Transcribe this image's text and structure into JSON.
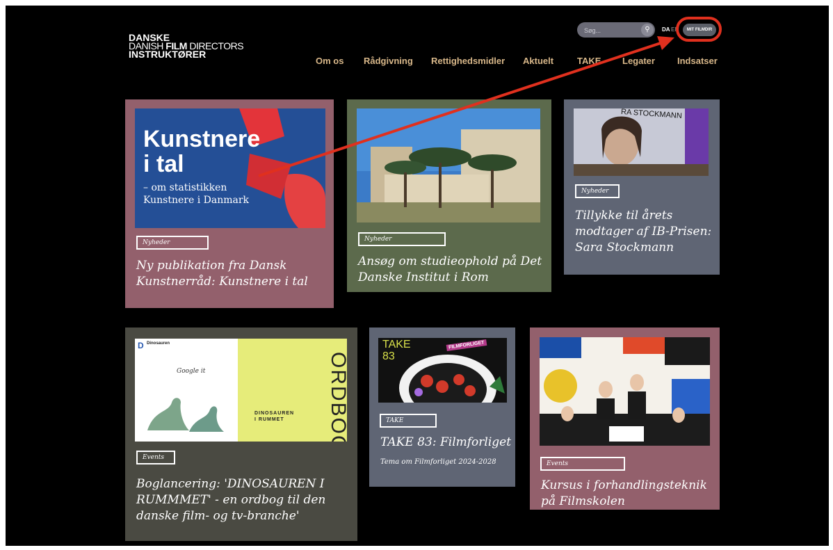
{
  "logo": {
    "line1": "DANSKE",
    "line2a": "DANISH ",
    "line2b": "FILM",
    "line2c": " DIRECTORS",
    "line3": "INSTRUKTØRER"
  },
  "search": {
    "placeholder": "Søg..."
  },
  "lang": {
    "da": "DA",
    "en": "EN"
  },
  "account_button": "MIT FILMDIR",
  "nav": [
    "Om os",
    "Rådgivning",
    "Rettighedsmidler",
    "Aktuelt",
    "TAKE",
    "Legater",
    "Indsatser"
  ],
  "cards": [
    {
      "tag": "Nyheder",
      "title": "Ny publikation fra Dansk Kunstnerråd: Kunstnere i tal",
      "image": {
        "headline1": "Kunstnere",
        "headline2": "i tal",
        "sub1": "– om statistikken",
        "sub2": "Kunstnere i Danmark"
      }
    },
    {
      "tag": "Nyheder",
      "title": "Ansøg om studieophold på Det Danske Institut i Rom"
    },
    {
      "tag": "Nyheder",
      "title": "Tillykke til årets modtager af IB-Prisen: Sara Stockmann",
      "image": {
        "banner": "RA STOCKMANN"
      }
    },
    {
      "tag": "Events",
      "title": "Boglancering: 'DINOSAUREN I RUMMMET' - en ordbog til den danske film- og tv-branche'",
      "image": {
        "letter": "D",
        "word": "Dinosauren",
        "bubble": "Google it",
        "cover": "ORDBOG",
        "cover_title1": "DINOSAUREN",
        "cover_title2": "I RUMMET"
      }
    },
    {
      "tag": "TAKE",
      "title": "TAKE 83: Filmforliget",
      "subtitle": "Tema om Filmforliget 2024-2028",
      "image": {
        "take": "TAKE",
        "num": "83",
        "label": "FILMFORLIGET"
      }
    },
    {
      "tag": "Events",
      "title": "Kursus i forhandlingsteknik på Filmskolen"
    }
  ],
  "colors": {
    "mauve": "#93606c",
    "olive": "#5c6a4c",
    "slate": "#5f6574",
    "darkolive": "#4a4a42",
    "nav": "#d9b88a",
    "annotation": "#e0301e"
  }
}
